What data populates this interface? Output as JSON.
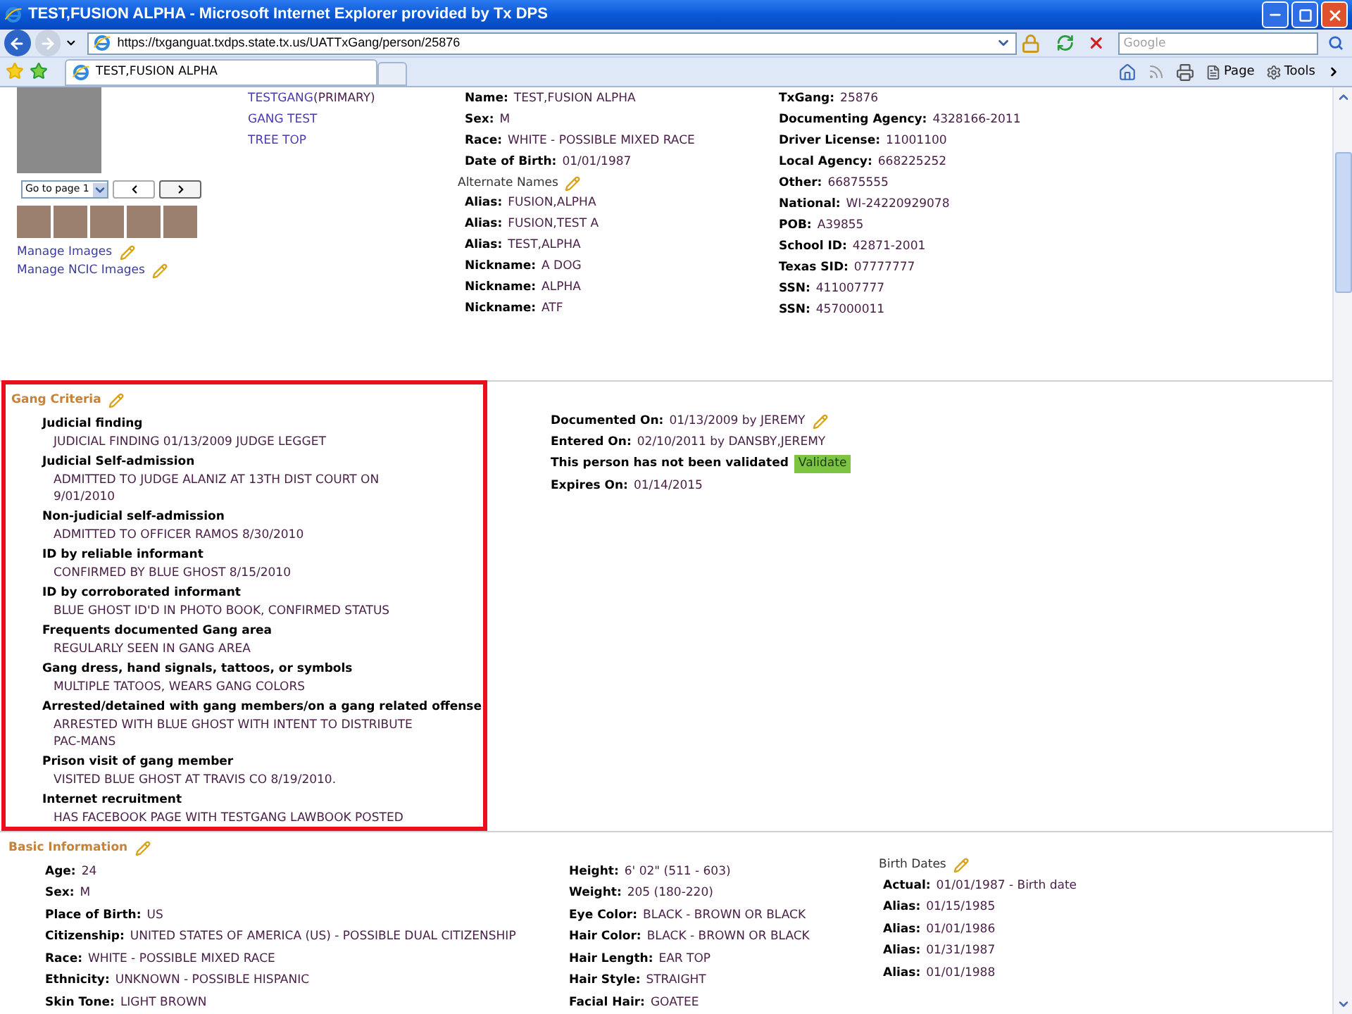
{
  "window": {
    "title": "TEST,FUSION ALPHA - Microsoft Internet Explorer provided by Tx DPS"
  },
  "address_bar": {
    "url": "https://txganguat.txdps.state.tx.us/UATTxGang/person/25876"
  },
  "search": {
    "placeholder": "Google"
  },
  "tabs": [
    {
      "label": "TEST,FUSION ALPHA",
      "selected": true
    }
  ],
  "command_bar": {
    "page": "Page",
    "tools": "Tools"
  },
  "gallery": {
    "page_select": "Go to page 1",
    "links": [
      "Manage Images",
      "Manage NCIC Images"
    ]
  },
  "gangs": [
    {
      "name": "TESTGANG",
      "note": "(PRIMARY)"
    },
    {
      "name": "GANG TEST"
    },
    {
      "name": "TREE TOP"
    }
  ],
  "person": [
    {
      "label": "Name:",
      "value": "TEST,FUSION ALPHA"
    },
    {
      "label": "Sex:",
      "value": "M"
    },
    {
      "label": "Race:",
      "value": "WHITE - POSSIBLE MIXED RACE"
    },
    {
      "label": "Date of Birth:",
      "value": "01/01/1987"
    }
  ],
  "alternate_names": {
    "title": "Alternate Names",
    "items": [
      {
        "label": "Alias:",
        "value": "FUSION,ALPHA"
      },
      {
        "label": "Alias:",
        "value": "FUSION,TEST A"
      },
      {
        "label": "Alias:",
        "value": "TEST,ALPHA"
      },
      {
        "label": "Nickname:",
        "value": "A DOG"
      },
      {
        "label": "Nickname:",
        "value": "ALPHA"
      },
      {
        "label": "Nickname:",
        "value": "ATF"
      }
    ]
  },
  "identifiers": [
    {
      "label": "TxGang:",
      "value": "25876"
    },
    {
      "label": "Documenting Agency:",
      "value": "4328166-2011"
    },
    {
      "label": "Driver License:",
      "value": "11001100"
    },
    {
      "label": "Local Agency:",
      "value": "668225252"
    },
    {
      "label": "Other:",
      "value": "66875555"
    },
    {
      "label": "National:",
      "value": "WI-24220929078"
    },
    {
      "label": "POB:",
      "value": "A39855"
    },
    {
      "label": "School ID:",
      "value": "42871-2001"
    },
    {
      "label": "Texas SID:",
      "value": "07777777"
    },
    {
      "label": "SSN:",
      "value": "411007777"
    },
    {
      "label": "SSN:",
      "value": "457000011"
    }
  ],
  "gang_criteria": {
    "title": "Gang Criteria",
    "criteria": [
      {
        "label": "Judicial finding",
        "value": "JUDICIAL FINDING 01/13/2009 JUDGE LEGGET"
      },
      {
        "label": "Judicial Self-admission",
        "value": "ADMITTED TO JUDGE ALANIZ AT 13TH DIST COURT ON 9/01/2010"
      },
      {
        "label": "Non-judicial self-admission",
        "value": "ADMITTED TO OFFICER RAMOS 8/30/2010"
      },
      {
        "label": "ID by reliable informant",
        "value": "CONFIRMED BY BLUE GHOST 8/15/2010"
      },
      {
        "label": "ID by corroborated informant",
        "value": "BLUE GHOST ID'D IN PHOTO BOOK, CONFIRMED STATUS"
      },
      {
        "label": "Frequents documented Gang area",
        "value": "REGULARLY SEEN IN GANG AREA"
      },
      {
        "label": "Gang dress, hand signals, tattoos, or symbols",
        "value": "MULTIPLE TATOOS, WEARS GANG COLORS"
      },
      {
        "label": "Arrested/detained with gang members/on a gang related offense",
        "value": "ARRESTED WITH BLUE GHOST WITH INTENT TO DISTRIBUTE PAC-MANS"
      },
      {
        "label": "Prison visit of gang member",
        "value": "VISITED BLUE GHOST AT TRAVIS CO 8/19/2010."
      },
      {
        "label": "Internet recruitment",
        "value": "HAS FACEBOOK PAGE WITH TESTGANG LAWBOOK POSTED"
      }
    ],
    "documented": {
      "label": "Documented On:",
      "value": "01/13/2009 by JEREMY"
    },
    "entered": {
      "label": "Entered On:",
      "value": "02/10/2011 by DANSBY,JEREMY"
    },
    "validation": {
      "text": "This person has not been validated",
      "button": "Validate"
    },
    "expires": {
      "label": "Expires On:",
      "value": "01/14/2015"
    }
  },
  "basic_information": {
    "title": "Basic Information",
    "columns": [
      [
        {
          "label": "Age:",
          "value": "24"
        },
        {
          "label": "Sex:",
          "value": "M"
        },
        {
          "label": "Place of Birth:",
          "value": "US"
        },
        {
          "label": "Citizenship:",
          "value": "UNITED STATES OF AMERICA (US) - POSSIBLE DUAL CITIZENSHIP"
        },
        {
          "label": "Race:",
          "value": "WHITE - POSSIBLE MIXED RACE"
        },
        {
          "label": "Ethnicity:",
          "value": "UNKNOWN - POSSIBLE HISPANIC"
        },
        {
          "label": "Skin Tone:",
          "value": "LIGHT BROWN"
        }
      ],
      [
        {
          "label": "Height:",
          "value": "6' 02\" (511 - 603)"
        },
        {
          "label": "Weight:",
          "value": "205 (180-220)"
        },
        {
          "label": "Eye Color:",
          "value": "BLACK - BROWN OR BLACK"
        },
        {
          "label": "Hair Color:",
          "value": "BLACK - BROWN OR BLACK"
        },
        {
          "label": "Hair Length:",
          "value": "EAR TOP"
        },
        {
          "label": "Hair Style:",
          "value": "STRAIGHT"
        },
        {
          "label": "Facial Hair:",
          "value": "GOATEE"
        }
      ]
    ],
    "birth_dates": {
      "title": "Birth Dates",
      "items": [
        {
          "label": "Actual:",
          "value": "01/01/1987 - Birth date"
        },
        {
          "label": "Alias:",
          "value": "01/15/1985"
        },
        {
          "label": "Alias:",
          "value": "01/01/1986"
        },
        {
          "label": "Alias:",
          "value": "01/31/1987"
        },
        {
          "label": "Alias:",
          "value": "01/01/1988"
        }
      ]
    }
  }
}
